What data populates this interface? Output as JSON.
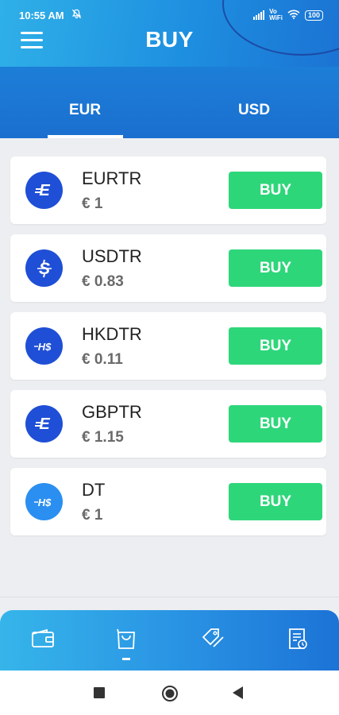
{
  "status_bar": {
    "time": "10:55 AM",
    "network_label": "Vo\nWiFi",
    "battery": "100"
  },
  "header": {
    "title": "BUY"
  },
  "tabs": [
    {
      "label": "EUR",
      "active": true
    },
    {
      "label": "USD",
      "active": false
    }
  ],
  "tokens": [
    {
      "name": "EURTR",
      "price": "€ 1",
      "icon": "euro-token-icon",
      "glyph": "E",
      "button": "BUY"
    },
    {
      "name": "USDTR",
      "price": "€ 0.83",
      "icon": "dollar-token-icon",
      "glyph": "S",
      "button": "BUY"
    },
    {
      "name": "HKDTR",
      "price": "€ 0.11",
      "icon": "hkd-token-icon",
      "glyph": "H$",
      "button": "BUY"
    },
    {
      "name": "GBPTR",
      "price": "€ 1.15",
      "icon": "euro-token-icon",
      "glyph": "E",
      "button": "BUY"
    },
    {
      "name": "DT",
      "price": "€ 1",
      "icon": "hkd-token-icon",
      "glyph": "H$",
      "button": "BUY"
    }
  ],
  "bottom_nav": [
    {
      "icon": "wallet-icon",
      "active": false
    },
    {
      "icon": "shopping-bag-icon",
      "active": true
    },
    {
      "icon": "tag-icon",
      "active": false
    },
    {
      "icon": "history-receipt-icon",
      "active": false
    }
  ],
  "colors": {
    "accent_blue": "#1b73d3",
    "buy_green": "#2ed67a",
    "coin_blue": "#1f4fd6",
    "coin_light_blue": "#2a8ff0"
  }
}
